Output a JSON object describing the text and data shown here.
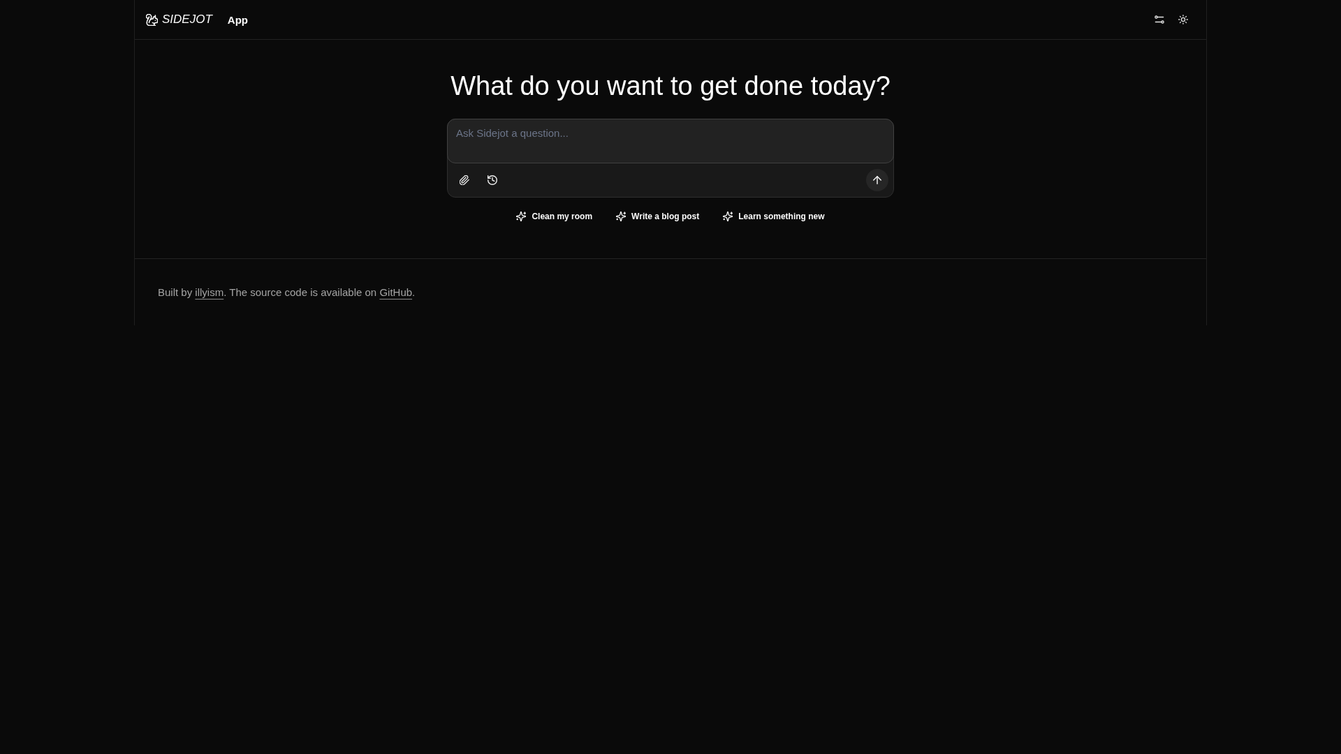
{
  "header": {
    "brand": "SIDEJOT",
    "nav": [
      "App"
    ]
  },
  "heading": "What do you want to get done today?",
  "composer": {
    "placeholder": "Ask Sidejot a question..."
  },
  "suggestions": [
    "Clean my room",
    "Write a blog post",
    "Learn something new"
  ],
  "footer": {
    "parts": [
      {
        "kind": "text",
        "text": "Built by "
      },
      {
        "kind": "link",
        "text": "illyism"
      },
      {
        "kind": "text",
        "text": ". The source code is available on "
      },
      {
        "kind": "link",
        "text": "GitHub"
      },
      {
        "kind": "text",
        "text": "."
      }
    ]
  }
}
